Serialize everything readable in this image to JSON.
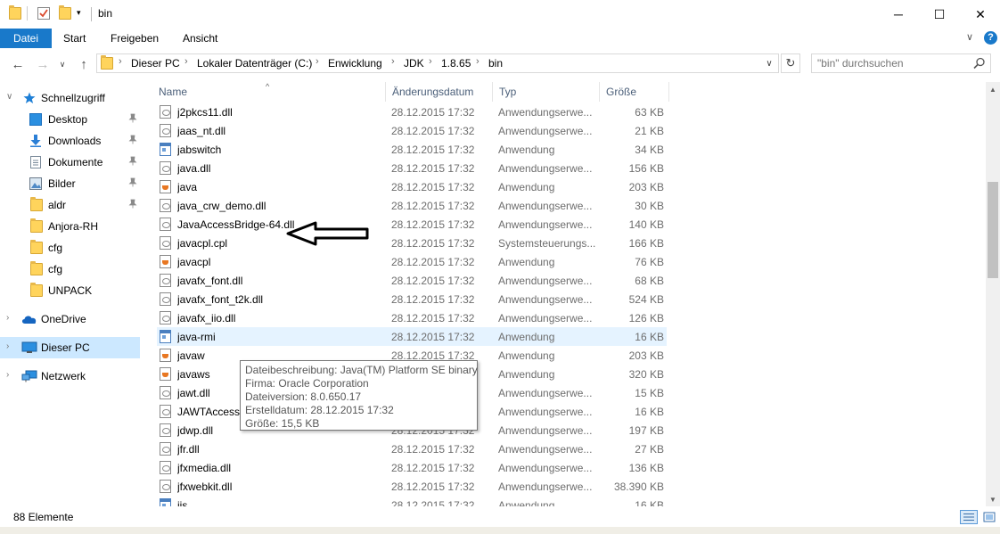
{
  "window": {
    "title": "bin",
    "minimize": "─",
    "maximize": "☐",
    "close": "✕"
  },
  "ribbon": {
    "tabs": [
      "Datei",
      "Start",
      "Freigeben",
      "Ansicht"
    ],
    "collapse": "∨",
    "help": "?"
  },
  "address": {
    "crumbs": [
      "Dieser PC",
      "Lokaler Datenträger (C:)",
      "Enwicklung",
      "JDK",
      "1.8.65",
      "bin"
    ],
    "separator": "›",
    "dropdown": "∨",
    "refresh": "↻"
  },
  "search": {
    "placeholder": "\"bin\" durchsuchen"
  },
  "nav": {
    "back": "←",
    "forward": "→",
    "recent": "∨",
    "up": "↑"
  },
  "navpane": {
    "quick_access": "Schnellzugriff",
    "items": [
      {
        "label": "Desktop",
        "icon": "desktop-icon",
        "pinned": true
      },
      {
        "label": "Downloads",
        "icon": "downloads-icon",
        "pinned": true
      },
      {
        "label": "Dokumente",
        "icon": "documents-icon",
        "pinned": true
      },
      {
        "label": "Bilder",
        "icon": "pictures-icon",
        "pinned": true
      },
      {
        "label": "aldr",
        "icon": "folder-icon",
        "pinned": true
      },
      {
        "label": "Anjora-RH",
        "icon": "folder-icon",
        "pinned": false
      },
      {
        "label": "cfg",
        "icon": "folder-icon",
        "pinned": false
      },
      {
        "label": "cfg",
        "icon": "folder-icon",
        "pinned": false
      },
      {
        "label": "UNPACK",
        "icon": "folder-icon",
        "pinned": false
      }
    ],
    "onedrive": "OneDrive",
    "this_pc": "Dieser PC",
    "network": "Netzwerk",
    "chevron": "›",
    "chevron_open": "∨",
    "pin_glyph": "📌"
  },
  "columns": {
    "name": "Name",
    "date": "Änderungsdatum",
    "type": "Typ",
    "size": "Größe",
    "sort_glyph": "^"
  },
  "files": [
    {
      "name": "j2pkcs11.dll",
      "date": "28.12.2015 17:32",
      "type": "Anwendungserwe...",
      "size": "63 KB",
      "icon": "dll"
    },
    {
      "name": "jaas_nt.dll",
      "date": "28.12.2015 17:32",
      "type": "Anwendungserwe...",
      "size": "21 KB",
      "icon": "dll"
    },
    {
      "name": "jabswitch",
      "date": "28.12.2015 17:32",
      "type": "Anwendung",
      "size": "34 KB",
      "icon": "exe"
    },
    {
      "name": "java.dll",
      "date": "28.12.2015 17:32",
      "type": "Anwendungserwe...",
      "size": "156 KB",
      "icon": "dll"
    },
    {
      "name": "java",
      "date": "28.12.2015 17:32",
      "type": "Anwendung",
      "size": "203 KB",
      "icon": "java"
    },
    {
      "name": "java_crw_demo.dll",
      "date": "28.12.2015 17:32",
      "type": "Anwendungserwe...",
      "size": "30 KB",
      "icon": "dll"
    },
    {
      "name": "JavaAccessBridge-64.dll",
      "date": "28.12.2015 17:32",
      "type": "Anwendungserwe...",
      "size": "140 KB",
      "icon": "dll"
    },
    {
      "name": "javacpl.cpl",
      "date": "28.12.2015 17:32",
      "type": "Systemsteuerungs...",
      "size": "166 KB",
      "icon": "dll"
    },
    {
      "name": "javacpl",
      "date": "28.12.2015 17:32",
      "type": "Anwendung",
      "size": "76 KB",
      "icon": "java"
    },
    {
      "name": "javafx_font.dll",
      "date": "28.12.2015 17:32",
      "type": "Anwendungserwe...",
      "size": "68 KB",
      "icon": "dll"
    },
    {
      "name": "javafx_font_t2k.dll",
      "date": "28.12.2015 17:32",
      "type": "Anwendungserwe...",
      "size": "524 KB",
      "icon": "dll"
    },
    {
      "name": "javafx_iio.dll",
      "date": "28.12.2015 17:32",
      "type": "Anwendungserwe...",
      "size": "126 KB",
      "icon": "dll"
    },
    {
      "name": "java-rmi",
      "date": "28.12.2015 17:32",
      "type": "Anwendung",
      "size": "16 KB",
      "icon": "exe"
    },
    {
      "name": "javaw",
      "date": "28.12.2015 17:32",
      "type": "Anwendung",
      "size": "203 KB",
      "icon": "java"
    },
    {
      "name": "javaws",
      "date": "28.12.2015 17:32",
      "type": "Anwendung",
      "size": "320 KB",
      "icon": "java"
    },
    {
      "name": "jawt.dll",
      "date": "28.12.2015 17:32",
      "type": "Anwendungserwe...",
      "size": "15 KB",
      "icon": "dll"
    },
    {
      "name": "JAWTAccessBridge-64.dll",
      "date": "28.12.2015 17:32",
      "type": "Anwendungserwe...",
      "size": "16 KB",
      "icon": "dll"
    },
    {
      "name": "jdwp.dll",
      "date": "28.12.2015 17:32",
      "type": "Anwendungserwe...",
      "size": "197 KB",
      "icon": "dll"
    },
    {
      "name": "jfr.dll",
      "date": "28.12.2015 17:32",
      "type": "Anwendungserwe...",
      "size": "27 KB",
      "icon": "dll"
    },
    {
      "name": "jfxmedia.dll",
      "date": "28.12.2015 17:32",
      "type": "Anwendungserwe...",
      "size": "136 KB",
      "icon": "dll"
    },
    {
      "name": "jfxwebkit.dll",
      "date": "28.12.2015 17:32",
      "type": "Anwendungserwe...",
      "size": "38.390 KB",
      "icon": "dll"
    },
    {
      "name": "jjs",
      "date": "28.12.2015 17:32",
      "type": "Anwendung",
      "size": "16 KB",
      "icon": "exe"
    }
  ],
  "hovered_index": 12,
  "tooltip": {
    "lines": [
      "Dateibeschreibung: Java(TM) Platform SE binary",
      "Firma: Oracle Corporation",
      "Dateiversion: 8.0.650.17",
      "Erstelldatum: 28.12.2015 17:32",
      "Größe: 15,5 KB"
    ]
  },
  "scrollbar": {
    "up": "▲",
    "down": "▼"
  },
  "status": {
    "count": "88 Elemente"
  },
  "colors": {
    "accent": "#1979ca",
    "selection": "#cce8ff",
    "hover": "#e5f3ff",
    "header_text": "#4c607a"
  }
}
